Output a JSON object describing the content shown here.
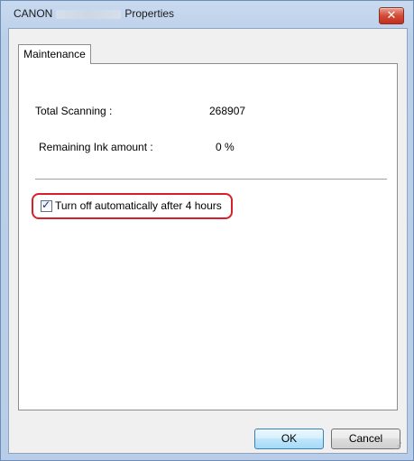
{
  "window": {
    "title_prefix": "CANON",
    "title_suffix": "Properties"
  },
  "tabs": [
    {
      "label": "Maintenance",
      "active": true
    }
  ],
  "maintenance": {
    "total_scanning_label": "Total Scanning :",
    "total_scanning_value": "268907",
    "remaining_ink_label": "Remaining Ink amount :",
    "remaining_ink_value": "0 %",
    "auto_off_label": "Turn off automatically after 4 hours",
    "auto_off_checked": true
  },
  "buttons": {
    "ok_label": "OK",
    "cancel_label": "Cancel",
    "close_glyph": "✕"
  },
  "colors": {
    "highlight_ring": "#d7202a",
    "close_button": "#d44a36",
    "default_button_border": "#3c7fb1"
  }
}
